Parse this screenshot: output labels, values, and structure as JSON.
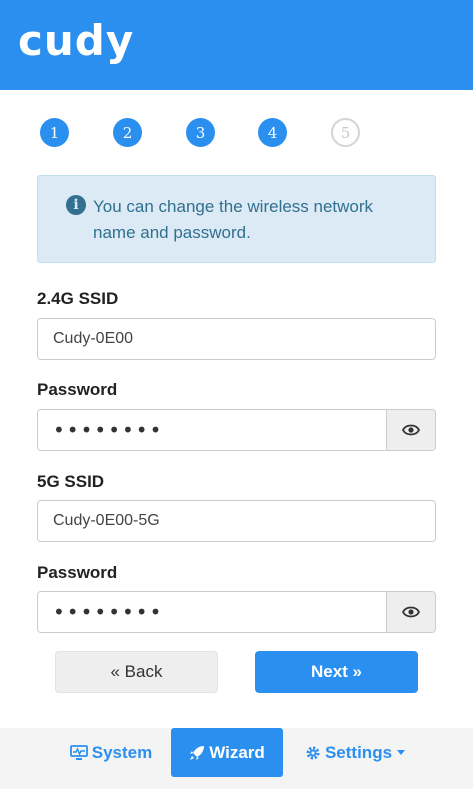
{
  "header": {
    "logo": "cudy"
  },
  "steps": [
    {
      "num": "1",
      "state": "active"
    },
    {
      "num": "2",
      "state": "active"
    },
    {
      "num": "3",
      "state": "active"
    },
    {
      "num": "4",
      "state": "active"
    },
    {
      "num": "5",
      "state": "inactive"
    }
  ],
  "alert": {
    "icon": "info-icon",
    "text": "You can change the wireless network name and password."
  },
  "form": {
    "ssid24_label": "2.4G SSID",
    "ssid24_value": "Cudy-0E00",
    "pwd24_label": "Password",
    "pwd24_value": "••••••••",
    "ssid5_label": "5G SSID",
    "ssid5_value": "Cudy-0E00-5G",
    "pwd5_label": "Password",
    "pwd5_value": "••••••••"
  },
  "buttons": {
    "back": "« Back",
    "next": "Next »"
  },
  "footer": {
    "system": "System",
    "wizard": "Wizard",
    "settings": "Settings"
  },
  "colors": {
    "brand": "#2b8ff0",
    "alert_bg": "#dbeaf5",
    "alert_text": "#31708f"
  }
}
